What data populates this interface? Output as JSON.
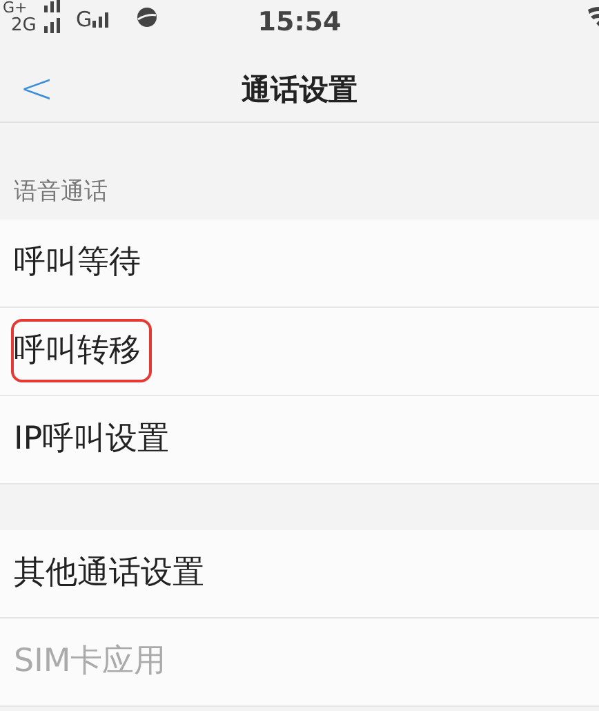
{
  "status_bar": {
    "network_1": "G+",
    "network_2": "2G",
    "network_3": "G",
    "time": "15:54"
  },
  "header": {
    "back": "<",
    "title": "通话设置"
  },
  "sections": [
    {
      "heading": "语音通话",
      "items": [
        {
          "label": "呼叫等待",
          "disabled": false,
          "highlighted": false
        },
        {
          "label": "呼叫转移",
          "disabled": false,
          "highlighted": true
        },
        {
          "label": "IP呼叫设置",
          "disabled": false,
          "highlighted": false
        }
      ]
    },
    {
      "items": [
        {
          "label": "其他通话设置",
          "disabled": false,
          "highlighted": false
        },
        {
          "label": "SIM卡应用",
          "disabled": true,
          "highlighted": false
        }
      ]
    }
  ]
}
